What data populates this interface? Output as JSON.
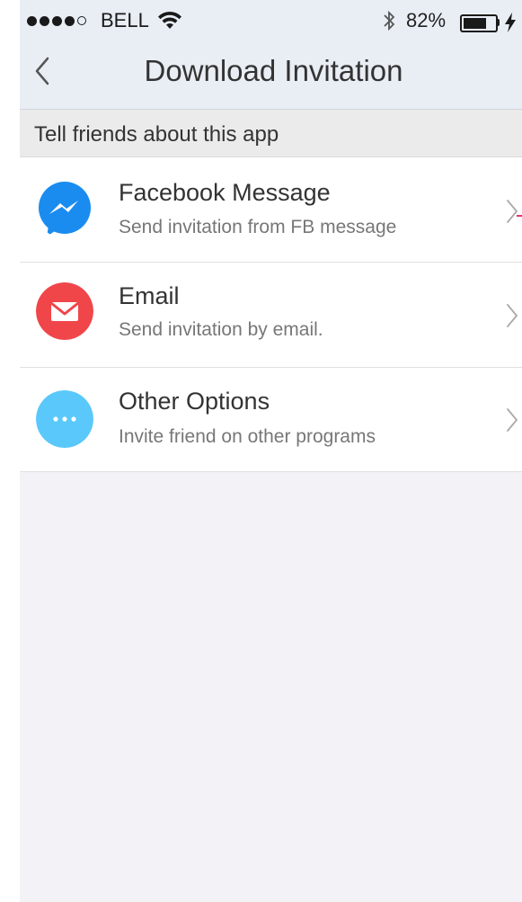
{
  "status_bar": {
    "carrier": "BELL",
    "battery_percent_label": "82%",
    "battery_level": 0.82,
    "signal_bars": 4,
    "signal_total": 5,
    "icons": [
      "wifi-icon",
      "bluetooth-icon",
      "battery-icon",
      "charging-bolt-icon"
    ]
  },
  "nav": {
    "title": "Download Invitation",
    "back_icon": "chevron-left-icon"
  },
  "section": {
    "header": "Tell friends about this app"
  },
  "options": [
    {
      "title": "Facebook Message",
      "subtitle": "Send invitation from FB message",
      "icon": "messenger-icon",
      "icon_color": "#1a8cf0"
    },
    {
      "title": "Email",
      "subtitle": "Send invitation by email.",
      "icon": "envelope-icon",
      "icon_color": "#f0464a"
    },
    {
      "title": "Other Options",
      "subtitle": "Invite friend on other programs",
      "icon": "more-dots-icon",
      "icon_color": "#5ac8fa"
    }
  ],
  "colors": {
    "nav_background": "#e9eef5",
    "page_background": "#f2f2f7",
    "section_background": "#ebebeb"
  }
}
